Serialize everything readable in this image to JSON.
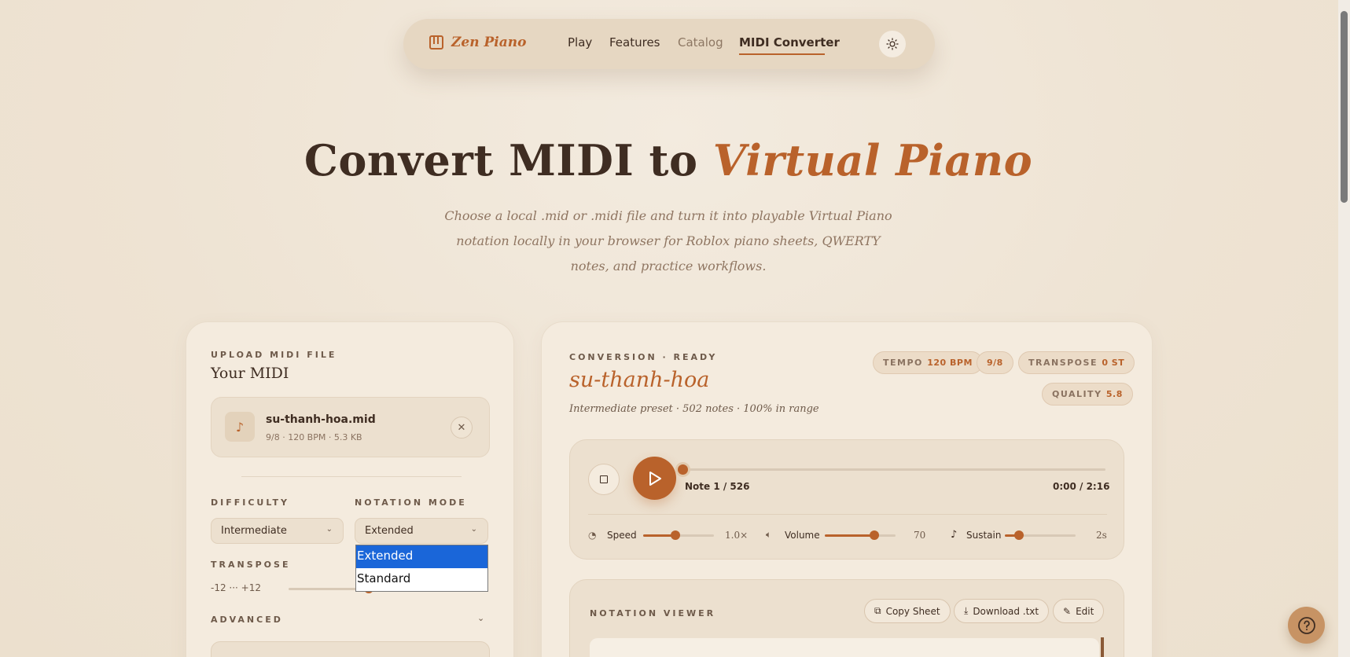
{
  "nav": {
    "brand": "Zen Piano",
    "links": [
      "Play",
      "Features",
      "Catalog",
      "MIDI Converter"
    ]
  },
  "hero": {
    "title_main": "Convert MIDI to ",
    "title_accent": "Virtual Piano",
    "subtitle": "Choose a local .mid or .midi file and turn it into playable Virtual Piano notation locally in your browser for Roblox piano sheets, QWERTY notes, and practice workflows."
  },
  "upload": {
    "eyebrow": "UPLOAD MIDI FILE",
    "heading": "Your MIDI",
    "file_name": "su-thanh-hoa.mid",
    "file_meta": "9/8 · 120 BPM · 5.3 KB",
    "difficulty_label": "DIFFICULTY",
    "difficulty_value": "Intermediate",
    "notation_label": "NOTATION MODE",
    "notation_value": "Extended",
    "notation_options": [
      "Extended",
      "Standard"
    ],
    "transpose_label": "TRANSPOSE",
    "transpose_range": "-12 ··· +12",
    "advanced_label": "ADVANCED"
  },
  "conversion": {
    "eyebrow": "CONVERSION · READY",
    "title": "su-thanh-hoa",
    "meta": "Intermediate preset · 502 notes · 100% in range",
    "pills": {
      "tempo_label": "TEMPO",
      "tempo_value": "120 BPM",
      "time_sig": "9/8",
      "transpose_label": "TRANSPOSE",
      "transpose_value": "0 ST",
      "quality_label": "QUALITY",
      "quality_value": "5.8"
    }
  },
  "player": {
    "note_counter": "Note 1 / 526",
    "time": "0:00 / 2:16",
    "progress": 0.0,
    "speed_label": "Speed",
    "speed_value": "1.0×",
    "speed_level": 0.45,
    "volume_label": "Volume",
    "volume_value": "70",
    "volume_level": 0.7,
    "sustain_label": "Sustain",
    "sustain_value": "2s",
    "sustain_level": 0.2
  },
  "viewer": {
    "eyebrow": "NOTATION VIEWER",
    "copy_label": "Copy Sheet",
    "download_label": "Download .txt",
    "edit_label": "Edit"
  },
  "colors": {
    "accent": "#b9622b",
    "background": "#efe5d6",
    "card": "#f4ebde",
    "dropdown_selected": "#1a66d9"
  }
}
